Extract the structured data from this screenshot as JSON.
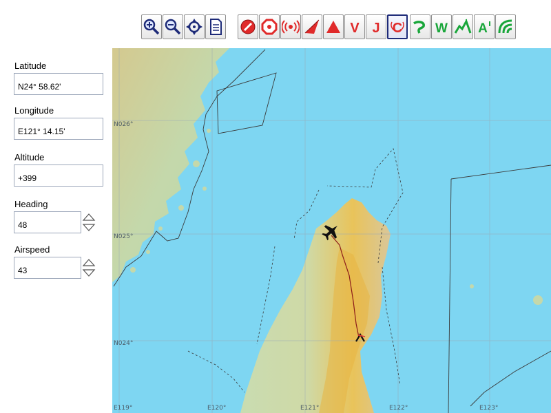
{
  "toolbar": {
    "buttons": [
      {
        "name": "zoom-in-button",
        "icon": "zoom-in-icon"
      },
      {
        "name": "zoom-out-button",
        "icon": "zoom-out-icon"
      },
      {
        "name": "center-map-button",
        "icon": "crosshair-icon"
      },
      {
        "name": "print-button",
        "icon": "document-icon"
      },
      {
        "name": "restricted-area-button",
        "icon": "no-entry-icon"
      },
      {
        "name": "airport-button",
        "icon": "octagon-icon"
      },
      {
        "name": "radio-beacon-button",
        "icon": "radio-waves-icon"
      },
      {
        "name": "route-button",
        "icon": "paper-plane-icon"
      },
      {
        "name": "obstacle-button",
        "icon": "triangle-icon"
      },
      {
        "name": "v-airway-button",
        "icon": "letter-v-icon",
        "label": "V"
      },
      {
        "name": "j-airway-button",
        "icon": "letter-j-icon",
        "label": "J"
      },
      {
        "name": "class-c-airspace-button",
        "icon": "letter-c-icon",
        "label": "C"
      },
      {
        "name": "lake-button",
        "icon": "lake-icon"
      },
      {
        "name": "waypoint-button",
        "icon": "letter-w-icon",
        "label": "W"
      },
      {
        "name": "terrain-button",
        "icon": "terrain-icon"
      },
      {
        "name": "altitude-button",
        "icon": "letter-a-icon",
        "label": "A"
      },
      {
        "name": "road-button",
        "icon": "road-icon"
      }
    ],
    "selected": "class-c-airspace-button",
    "colors": {
      "red": "#e02a2a",
      "green": "#19a63a",
      "selected_border": "#1d2a78"
    }
  },
  "fields": {
    "latitude": {
      "label": "Latitude",
      "value": "N24° 58.62'"
    },
    "longitude": {
      "label": "Longitude",
      "value": "E121° 14.15'"
    },
    "altitude": {
      "label": "Altitude",
      "value": "+399"
    },
    "heading": {
      "label": "Heading",
      "value": "48"
    },
    "airspeed": {
      "label": "Airspeed",
      "value": "43"
    }
  },
  "map": {
    "grid_labels": {
      "lat": [
        "N026°",
        "N025°",
        "N024°"
      ],
      "lon": [
        "E119°",
        "E120°",
        "E121°",
        "E122°",
        "E123°"
      ]
    },
    "icons": [
      "aircraft-icon",
      "destination-airport-icon"
    ],
    "colors": {
      "sea": "#7ed6f2",
      "land_low": "#c8dcae",
      "land_high": "#e8b441",
      "track": "#8b1a1a",
      "boundary": "#3a3a3a"
    }
  }
}
